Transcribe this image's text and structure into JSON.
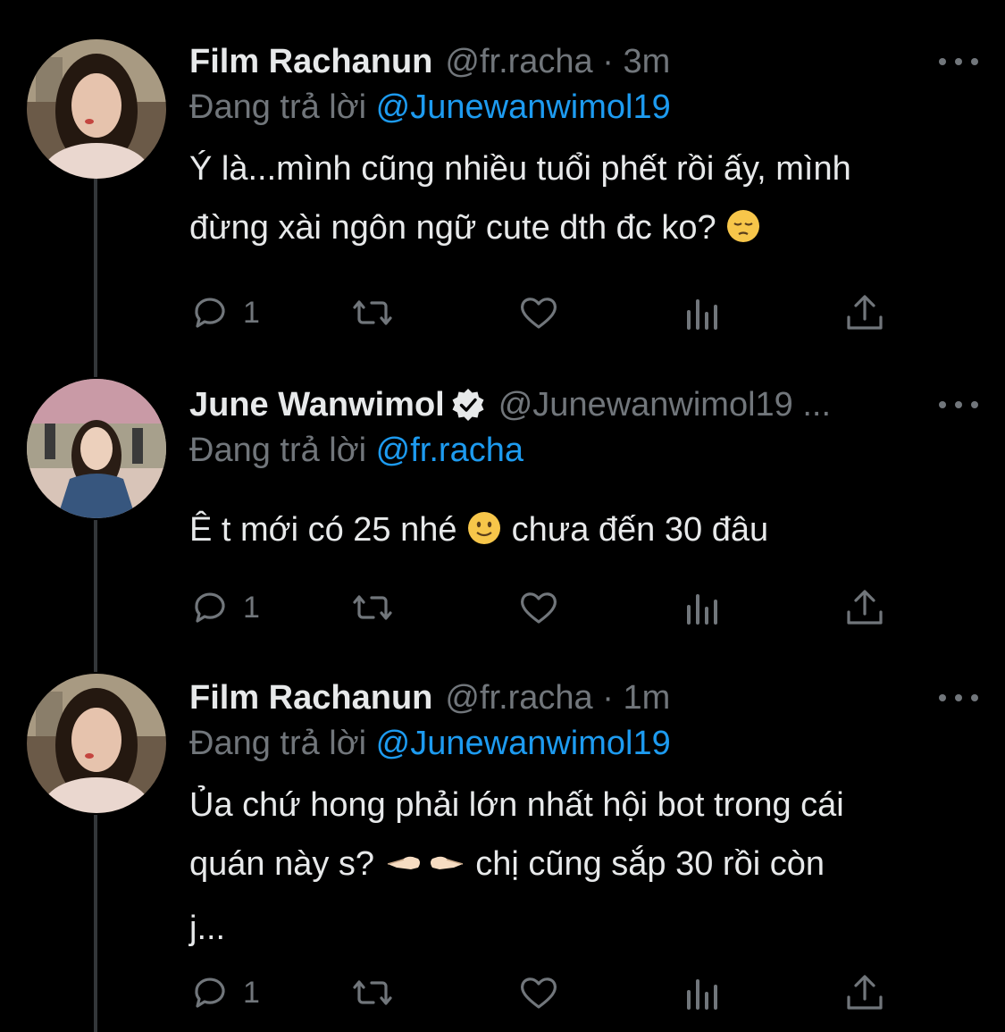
{
  "tweets": [
    {
      "name": "Film Rachanun",
      "handle": "@fr.racha · 3m",
      "verified": false,
      "reply_prefix": "Đang trả lời ",
      "reply_mention": "@Junewanwimol19",
      "text_lines": [
        "Ý là...mình cũng nhiều tuổi phết rồi ấy, mình",
        "đừng xài ngôn ngữ cute dth đc ko?"
      ],
      "emoji": "pensive-face",
      "reply_count": "1"
    },
    {
      "name": "June Wanwimol",
      "handle": "@Junewanwimol19 ...",
      "verified": true,
      "reply_prefix": "Đang trả lời ",
      "reply_mention": "@fr.racha",
      "text_a": "Ê t mới có 25 nhé",
      "text_b": " chưa đến 30 đâu",
      "emoji": "slightly-smiling-face",
      "reply_count": "1"
    },
    {
      "name": "Film Rachanun",
      "handle": "@fr.racha · 1m",
      "verified": false,
      "reply_prefix": "Đang trả lời ",
      "reply_mention": "@Junewanwimol19",
      "text_line1": "Ủa chứ hong phải lớn nhất hội bot trong cái",
      "text_line2a": "quán này s?",
      "text_line2b": " chị cũng sắp 30 rồi còn",
      "text_line3": "j...",
      "emoji": "pointing-fingers",
      "reply_count": "1"
    }
  ],
  "colors": {
    "background": "#000000",
    "text": "#e7e9ea",
    "muted": "#71767b",
    "mention": "#1d9bf0",
    "thread_line": "#333639"
  }
}
